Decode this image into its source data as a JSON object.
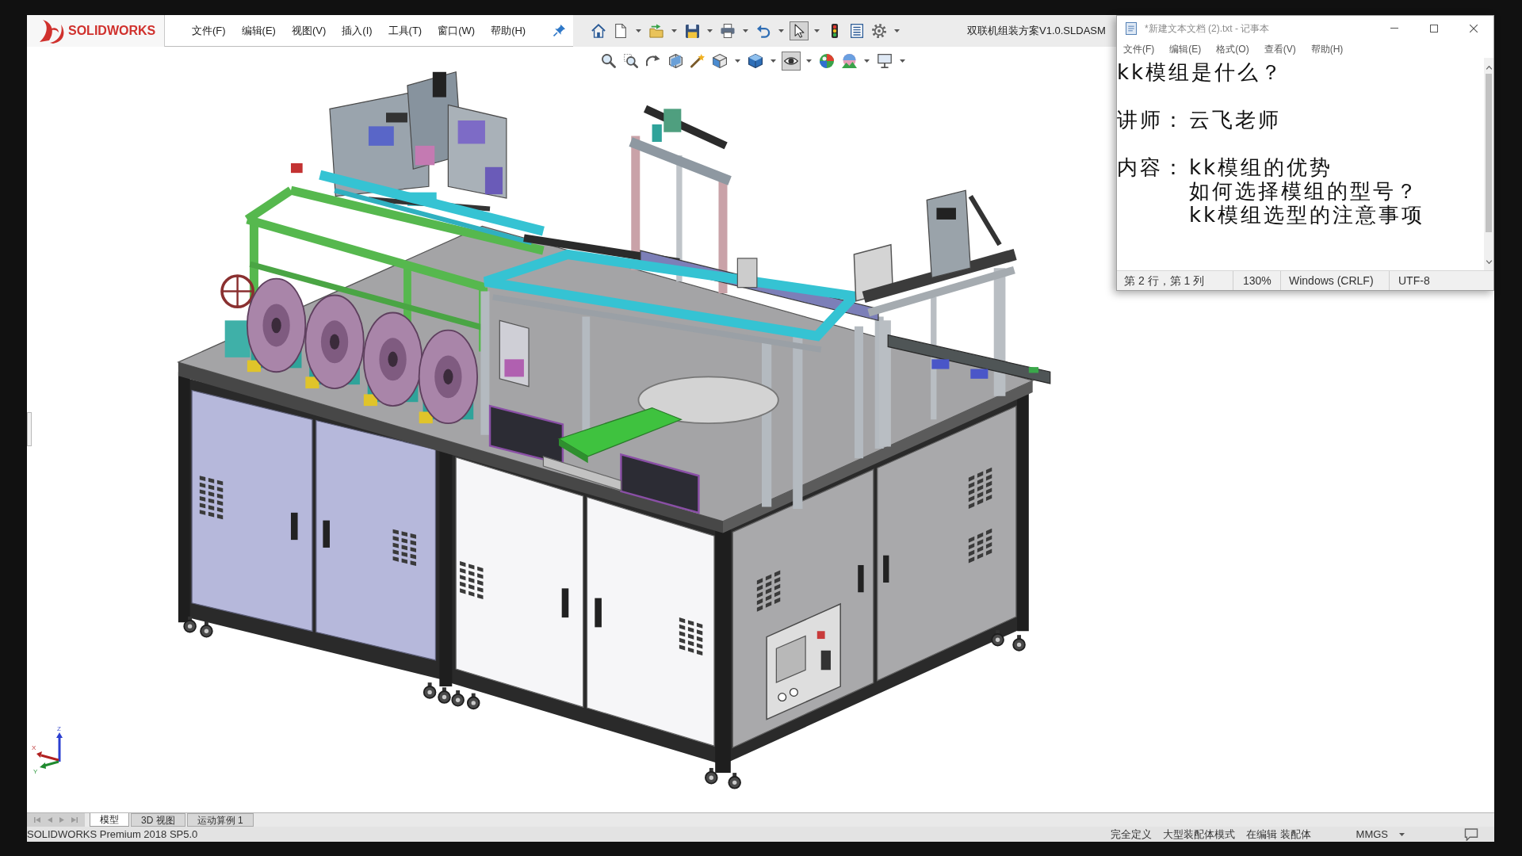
{
  "app": {
    "logo_text": "SOLIDWORKS",
    "menu": [
      "文件(F)",
      "编辑(E)",
      "视图(V)",
      "插入(I)",
      "工具(T)",
      "窗口(W)",
      "帮助(H)"
    ],
    "document_title": "双联机组装方案V1.0.SLDASM"
  },
  "toolbar": [
    {
      "pressed": false
    },
    {
      "pressed": false
    },
    {
      "pressed": false
    },
    {
      "pressed": false
    },
    {
      "pressed": false
    },
    {
      "pressed": false
    },
    {
      "pressed": true
    },
    {
      "pressed": false
    },
    {
      "pressed": false
    },
    {
      "pressed": false
    }
  ],
  "view_toolbar": [
    {
      "pressed": false
    },
    {
      "pressed": false
    },
    {
      "pressed": false
    },
    {
      "pressed": false
    },
    {
      "pressed": false
    },
    {
      "pressed": false
    },
    {
      "pressed": false
    },
    {
      "pressed": true
    },
    {
      "pressed": false
    },
    {
      "pressed": false
    },
    {
      "pressed": false
    }
  ],
  "triad": {
    "axis_labels": [
      "Z",
      "X",
      "Y"
    ]
  },
  "tabs": [
    {
      "label": "模型",
      "selected": true
    },
    {
      "label": "3D 视图",
      "selected": false
    },
    {
      "label": "运动算例 1",
      "selected": false
    }
  ],
  "status_bar": {
    "product": "SOLIDWORKS Premium 2018 SP5.0",
    "items": [
      "完全定义",
      "大型装配体模式",
      "在编辑 装配体"
    ],
    "units": "MMGS"
  },
  "notepad": {
    "title": "*新建文本文档 (2).txt - 记事本",
    "menu": [
      "文件(F)",
      "编辑(E)",
      "格式(O)",
      "查看(V)",
      "帮助(H)"
    ],
    "document": [
      {
        "kind": "heading",
        "text": "kk模组是什么？"
      },
      {
        "kind": "field",
        "label": "讲师：",
        "lines": [
          "云飞老师"
        ]
      },
      {
        "kind": "field",
        "label": "内容：",
        "lines": [
          "kk模组的优势",
          "如何选择模组的型号？",
          "kk模组选型的注意事项"
        ]
      }
    ],
    "status": [
      "第 2 行，第 1 列",
      "130%",
      "Windows (CRLF)",
      "UTF-8"
    ]
  }
}
